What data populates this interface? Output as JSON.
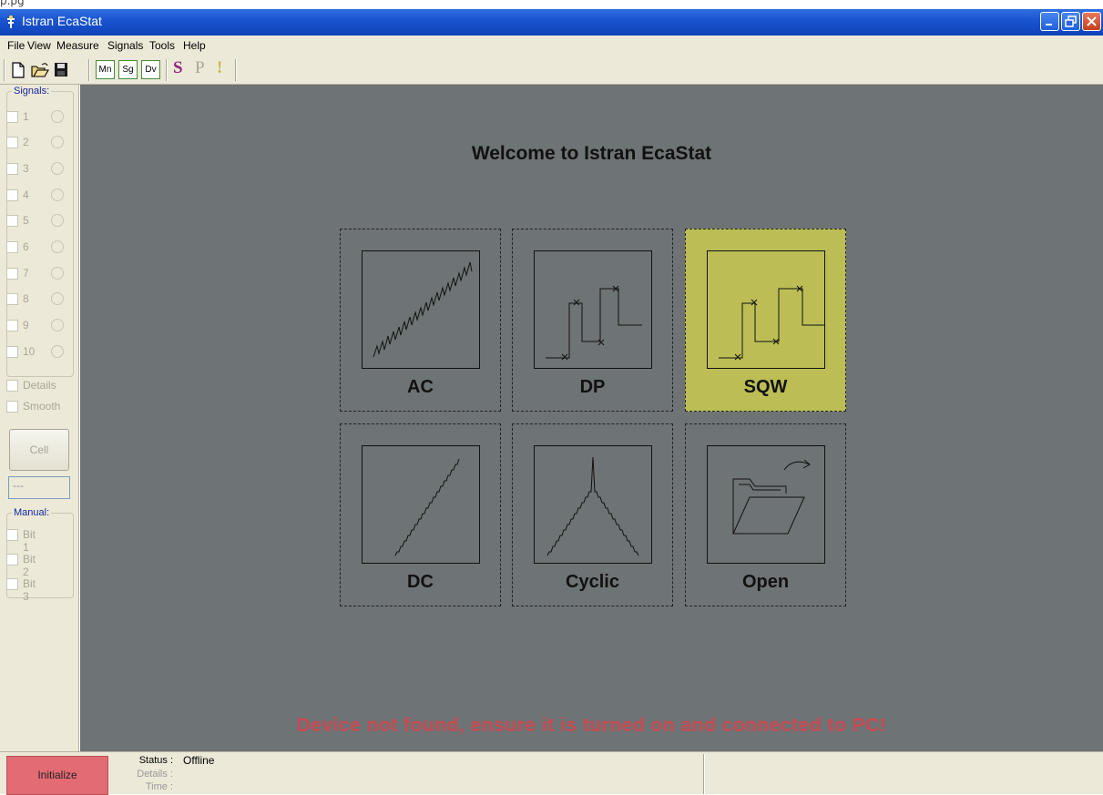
{
  "top_strip_text": "p.pg",
  "window": {
    "title": "Istran EcaStat"
  },
  "menu": [
    "File",
    "View",
    "Measure",
    "Signals",
    "Tools",
    "Help"
  ],
  "toolbar": {
    "buttons": [
      "new-file",
      "open-folder",
      "save-disk"
    ],
    "mode_buttons": [
      "Mn",
      "Sg",
      "Dv"
    ],
    "letters": [
      "S",
      "P",
      "!"
    ]
  },
  "sidebar": {
    "signals_title": "Signals:",
    "signals": [
      "1",
      "2",
      "3",
      "4",
      "5",
      "6",
      "7",
      "8",
      "9",
      "10"
    ],
    "options": [
      "Details",
      "Smooth"
    ],
    "cell_button": "Cell",
    "field_value": "---",
    "manual_title": "Manual:",
    "bits": [
      "Bit 1",
      "Bit 2",
      "Bit 3"
    ]
  },
  "main": {
    "welcome": "Welcome to Istran EcaStat",
    "tiles": [
      {
        "label": "AC",
        "selected": false
      },
      {
        "label": "DP",
        "selected": false
      },
      {
        "label": "SQW",
        "selected": true
      },
      {
        "label": "DC",
        "selected": false
      },
      {
        "label": "Cyclic",
        "selected": false
      },
      {
        "label": "Open",
        "selected": false
      }
    ],
    "warning": "Device not found, ensure it is turned on and connected to PC!"
  },
  "status": {
    "initialize": "Initialize",
    "status_label": "Status :",
    "status_value": "Offline",
    "details_label": "Details :",
    "time_label": "Time :"
  },
  "colors": {
    "workspace": "#6e7375",
    "selected_tile": "#bcbe55",
    "warning": "#c84a52",
    "initialize": "#e36b74"
  }
}
